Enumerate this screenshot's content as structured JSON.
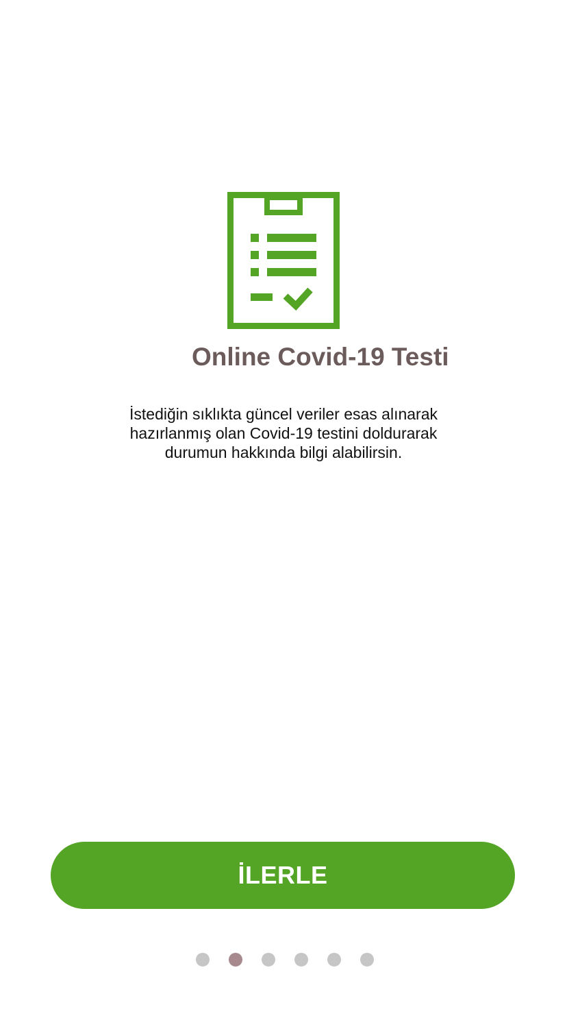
{
  "onboarding": {
    "icon": "clipboard-checklist-icon",
    "title": "Online Covid-19 Testi",
    "description_lines": [
      "İstediğin sıklıkta güncel veriler esas alınarak",
      "hazırlanmış olan Covid-19 testini doldurarak",
      "durumun hakkında bilgi alabilirsin."
    ],
    "next_button_label": "İLERLE",
    "page_indicator": {
      "total": 6,
      "current": 2
    }
  },
  "colors": {
    "accent": "#54a425",
    "title": "#6b5b5b",
    "indicator_active": "#a68a8e",
    "indicator_inactive": "#c6c6c6"
  }
}
